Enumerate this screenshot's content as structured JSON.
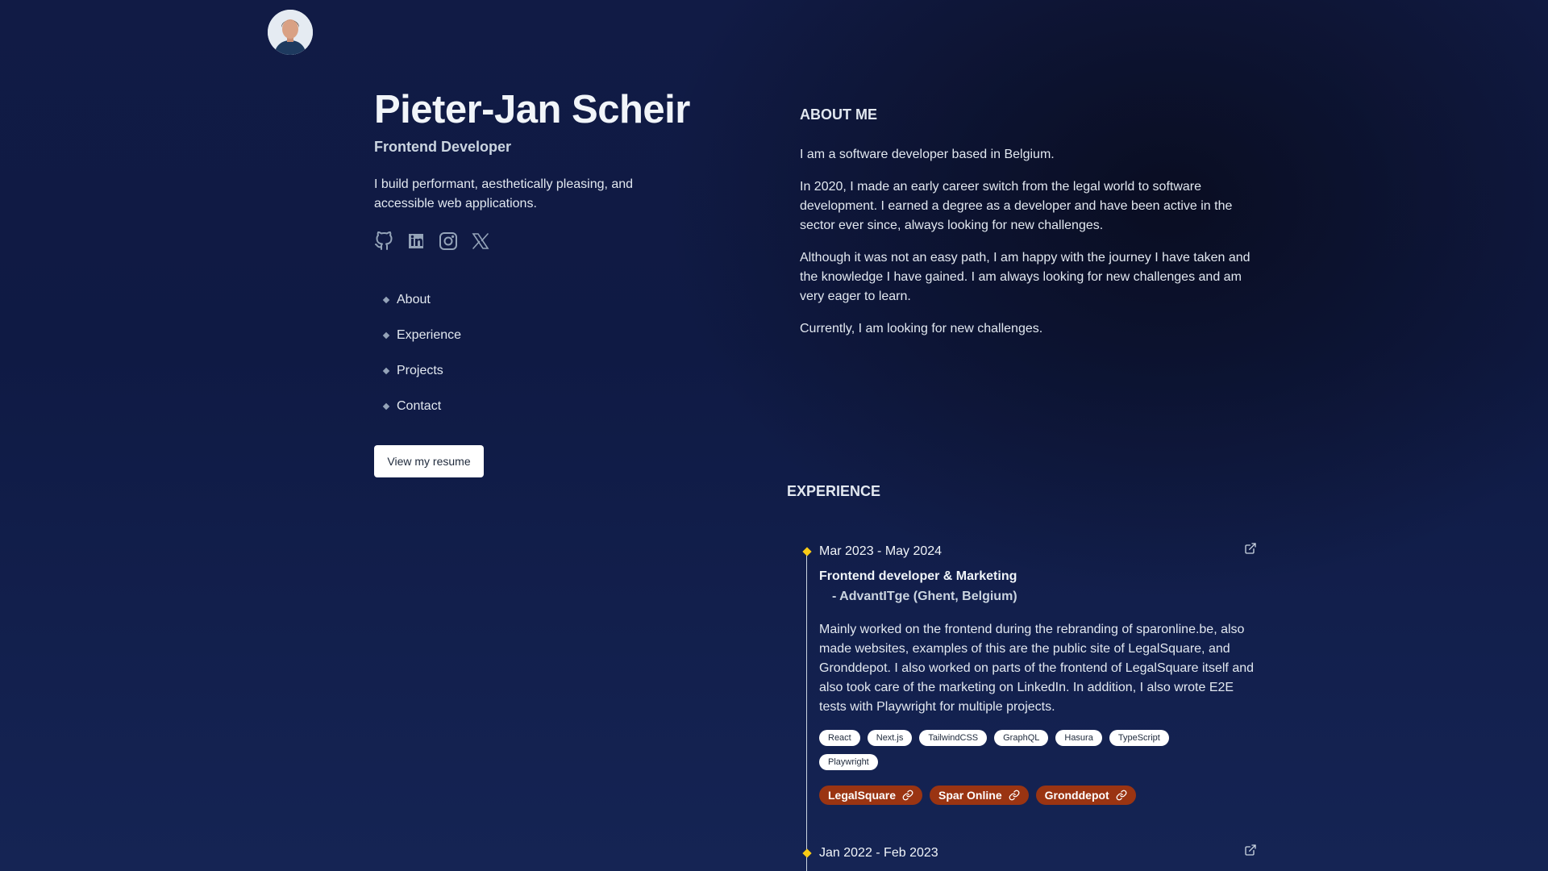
{
  "profile": {
    "name": "Pieter-Jan Scheir",
    "role": "Frontend Developer",
    "tagline": "I build performant, aesthetically pleasing, and accessible web applications."
  },
  "socials": [
    {
      "icon": "github-icon"
    },
    {
      "icon": "linkedin-icon"
    },
    {
      "icon": "instagram-icon"
    },
    {
      "icon": "x-icon"
    }
  ],
  "nav": {
    "items": [
      {
        "label": "About"
      },
      {
        "label": "Experience"
      },
      {
        "label": "Projects"
      },
      {
        "label": "Contact"
      }
    ]
  },
  "resume_button": "View my resume",
  "about": {
    "title": "ABOUT ME",
    "paragraphs": [
      "I am a software developer based in Belgium.",
      "In 2020, I made an early career switch from the legal world to software development. I earned a degree as a developer and have been active in the sector ever since, always looking for new challenges.",
      "Although it was not an easy path, I am happy with the journey I have taken and the knowledge I have gained. I am always looking for new challenges and am very eager to learn.",
      "Currently, I am looking for new challenges."
    ]
  },
  "experience": {
    "title": "EXPERIENCE",
    "jobs": [
      {
        "date": "Mar 2023 - May 2024",
        "title": "Frontend developer & Marketing",
        "company": "- AdvantITge (Ghent, Belgium)",
        "description": "Mainly worked on the frontend during the rebranding of sparonline.be, also made websites, examples of this are the public site of LegalSquare, and Gronddepot. I also worked on parts of the frontend of LegalSquare itself and also took care of the marketing on LinkedIn. In addition, I also wrote E2E tests with Playwright for multiple projects.",
        "tags": [
          "React",
          "Next.js",
          "TailwindCSS",
          "GraphQL",
          "Hasura",
          "TypeScript",
          "Playwright"
        ],
        "links": [
          "LegalSquare",
          "Spar Online",
          "Gronddepot"
        ]
      },
      {
        "date": "Jan 2022 - Feb 2023"
      }
    ]
  },
  "colors": {
    "accent_diamond": "#facc15",
    "project_link_bg": "#9a3412",
    "background": "#111b45"
  }
}
